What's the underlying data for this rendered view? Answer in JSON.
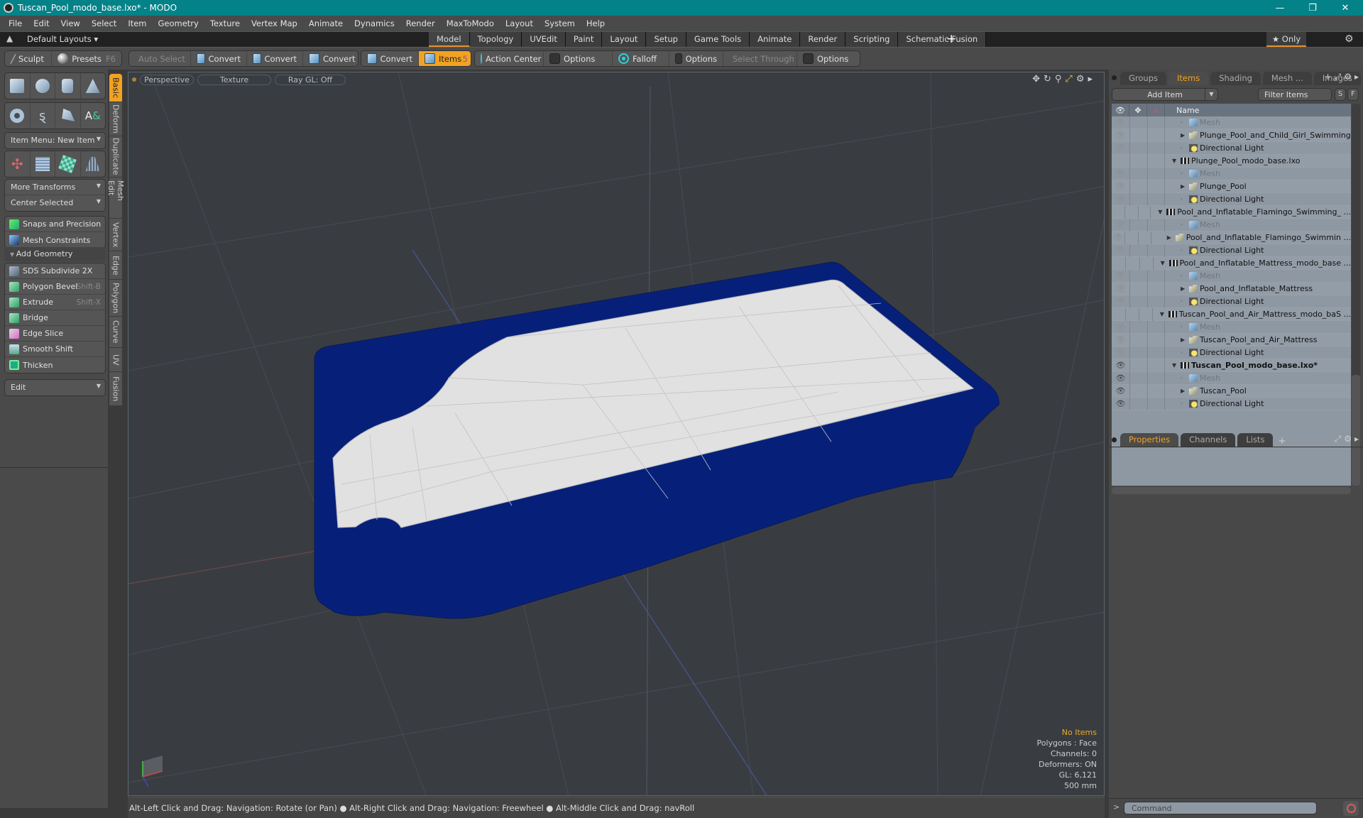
{
  "window": {
    "title": "Tuscan_Pool_modo_base.lxo* - MODO",
    "controls": {
      "minimize": "—",
      "restore": "❐",
      "close": "✕"
    }
  },
  "menu": [
    "File",
    "Edit",
    "View",
    "Select",
    "Item",
    "Geometry",
    "Texture",
    "Vertex Map",
    "Animate",
    "Dynamics",
    "Render",
    "MaxToModo",
    "Layout",
    "System",
    "Help"
  ],
  "layoutbar": {
    "layouts_label": "Default Layouts ▾",
    "tabs": [
      "Model",
      "Topology",
      "UVEdit",
      "Paint",
      "Layout",
      "Setup",
      "Game Tools",
      "Animate",
      "Render",
      "Scripting",
      "Schematic Fusion"
    ],
    "active_tab": "Model",
    "add": "+",
    "only_label": "★ Only"
  },
  "toolbar": {
    "sculpt": "Sculpt",
    "presets": "Presets",
    "presets_key": "F6",
    "auto_select": "Auto Select",
    "convert1": "Convert",
    "convert2": "Convert",
    "convert3": "Convert",
    "convert4": "Convert",
    "items": "Items",
    "items_key": "5",
    "action_center": "Action Center",
    "options1": "Options",
    "falloff": "Falloff",
    "options2": "Options",
    "select_through": "Select Through",
    "options3": "Options"
  },
  "leftpanel": {
    "item_menu": "Item Menu: New Item",
    "more_transforms": "More Transforms",
    "center_selected": "Center Selected",
    "snaps": "Snaps and Precision",
    "mesh_constraints": "Mesh Constraints",
    "add_geometry": "Add Geometry",
    "tools": [
      {
        "label": "SDS Subdivide 2X",
        "shortcut": ""
      },
      {
        "label": "Polygon Bevel",
        "shortcut": "Shift-B"
      },
      {
        "label": "Extrude",
        "shortcut": "Shift-X"
      },
      {
        "label": "Bridge",
        "shortcut": ""
      },
      {
        "label": "Edge Slice",
        "shortcut": ""
      },
      {
        "label": "Smooth Shift",
        "shortcut": ""
      },
      {
        "label": "Thicken",
        "shortcut": ""
      }
    ],
    "edit_dropdown": "Edit",
    "side_tabs": [
      "Basic",
      "Deform",
      "Duplicate",
      "Mesh Edit",
      "Vertex",
      "Edge",
      "Polygon",
      "Curve",
      "UV",
      "Fusion"
    ]
  },
  "viewport": {
    "view_mode": "Perspective",
    "shading": "Texture",
    "raygl": "Ray GL: Off",
    "info": {
      "selection": "No Items",
      "polygons": "Polygons : Face",
      "channels": "Channels: 0",
      "deformers": "Deformers: ON",
      "gl": "GL: 6,121",
      "scale": "500 mm"
    },
    "colors": {
      "background": "#393d42",
      "pool_shell": "#06207a",
      "pool_interior": "#e1e1e1"
    }
  },
  "statusbar": "Alt-Left Click and Drag: Navigation: Rotate (or Pan) ● Alt-Right Click and Drag: Navigation: Freewheel ● Alt-Middle Click and Drag: navRoll",
  "rightpanel": {
    "top_tabs": [
      "Groups",
      "Items",
      "Shading",
      "Mesh ...",
      "Images"
    ],
    "active_top_tab": "Items",
    "add_item": "Add Item",
    "filter_placeholder": "Filter Items",
    "s_btn": "S",
    "f_btn": "F",
    "tree_header": "Name",
    "tree": [
      {
        "label": "Mesh",
        "type": "mesh",
        "level": 2,
        "dim": true,
        "eye": true
      },
      {
        "label": "Plunge_Pool_and_Child_Girl_Swimming",
        "type": "group",
        "level": 2,
        "expand": "▶",
        "eye": true
      },
      {
        "label": "Directional Light",
        "type": "light",
        "level": 2,
        "eye": true
      },
      {
        "label": "Plunge_Pool_modo_base.lxo",
        "type": "scene",
        "level": 1,
        "expand": "▼",
        "eye": false
      },
      {
        "label": "Mesh",
        "type": "mesh",
        "level": 2,
        "dim": true,
        "eye": true
      },
      {
        "label": "Plunge_Pool",
        "type": "group",
        "level": 2,
        "expand": "▶",
        "eye": true
      },
      {
        "label": "Directional Light",
        "type": "light",
        "level": 2,
        "eye": true
      },
      {
        "label": "Pool_and_Inflatable_Flamingo_Swimming_ ...",
        "type": "scene",
        "level": 1,
        "expand": "▼",
        "eye": false
      },
      {
        "label": "Mesh",
        "type": "mesh",
        "level": 2,
        "dim": true,
        "eye": true
      },
      {
        "label": "Pool_and_Inflatable_Flamingo_Swimmin ...",
        "type": "group",
        "level": 2,
        "expand": "▶",
        "eye": true
      },
      {
        "label": "Directional Light",
        "type": "light",
        "level": 2,
        "eye": true
      },
      {
        "label": "Pool_and_Inflatable_Mattress_modo_base ...",
        "type": "scene",
        "level": 1,
        "expand": "▼",
        "eye": false
      },
      {
        "label": "Mesh",
        "type": "mesh",
        "level": 2,
        "dim": true,
        "eye": true
      },
      {
        "label": "Pool_and_Inflatable_Mattress",
        "type": "group",
        "level": 2,
        "expand": "▶",
        "eye": true
      },
      {
        "label": "Directional Light",
        "type": "light",
        "level": 2,
        "eye": true
      },
      {
        "label": "Tuscan_Pool_and_Air_Mattress_modo_baS ...",
        "type": "scene",
        "level": 1,
        "expand": "▼",
        "eye": false
      },
      {
        "label": "Mesh",
        "type": "mesh",
        "level": 2,
        "dim": true,
        "eye": true
      },
      {
        "label": "Tuscan_Pool_and_Air_Mattress",
        "type": "group",
        "level": 2,
        "expand": "▶",
        "eye": true
      },
      {
        "label": "Directional Light",
        "type": "light",
        "level": 2,
        "eye": true
      },
      {
        "label": "Tuscan_Pool_modo_base.lxo*",
        "type": "scene",
        "level": 1,
        "expand": "▼",
        "eye": true,
        "bold": true
      },
      {
        "label": "Mesh",
        "type": "mesh",
        "level": 2,
        "dim": true,
        "eye": true
      },
      {
        "label": "Tuscan_Pool",
        "type": "group",
        "level": 2,
        "expand": "▶",
        "eye": true
      },
      {
        "label": "Directional Light",
        "type": "light",
        "level": 2,
        "eye": true
      }
    ],
    "bottom_tabs": [
      "Properties",
      "Channels",
      "Lists"
    ],
    "active_bottom_tab": "Properties",
    "command_placeholder": "Command",
    "command_prompt": ">"
  }
}
